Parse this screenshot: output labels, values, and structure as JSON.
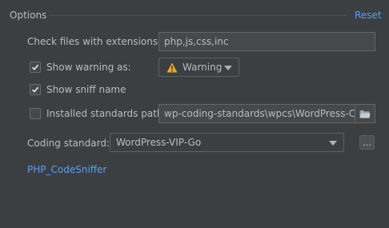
{
  "header": {
    "title": "Options",
    "reset_label": "Reset"
  },
  "extensions": {
    "label": "Check files with extensions:",
    "value": "php,js,css,inc"
  },
  "show_warning": {
    "label": "Show warning as:",
    "checked": true,
    "selected": "Warning",
    "icon": "warning-triangle-icon"
  },
  "show_sniff": {
    "label": "Show sniff name",
    "checked": true
  },
  "standards_path": {
    "label": "Installed standards path:",
    "checked": false,
    "value": "wp-coding-standards\\wpcs\\WordPress-Core",
    "browse_icon": "folder-icon"
  },
  "coding_standard": {
    "label": "Coding standard:",
    "selected": "WordPress-VIP-Go",
    "more_label": "..."
  },
  "footer": {
    "link_label": "PHP_CodeSniffer"
  },
  "colors": {
    "background": "#3c3f41",
    "text": "#bbbbbb",
    "link": "#589df6",
    "warning_icon": "#f0a732"
  }
}
